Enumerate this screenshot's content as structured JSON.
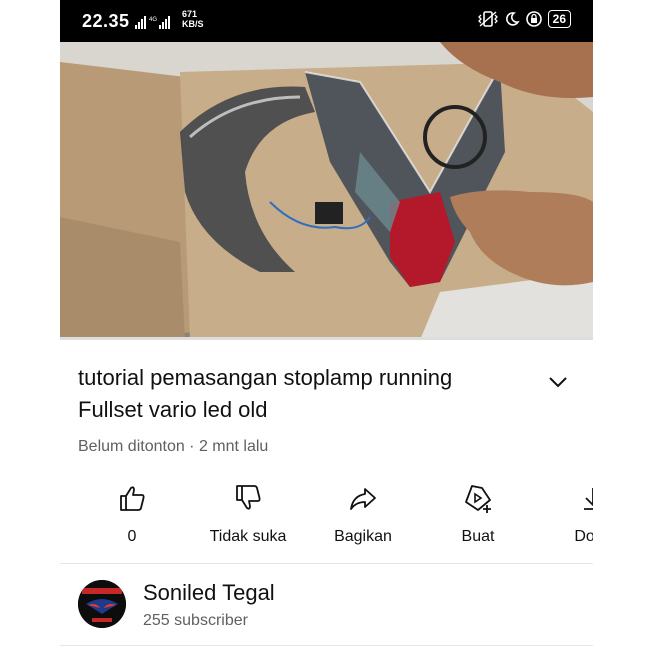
{
  "status_bar": {
    "time": "22.35",
    "network": "4G",
    "speed_value": "671",
    "speed_unit": "KB/S",
    "battery": "26"
  },
  "video": {
    "progress": 0.0,
    "colors": {
      "progress_track": "#dddddd",
      "progress_fill": "#e00000"
    }
  },
  "title": "tutorial pemasangan stoplamp running Fullset vario led old",
  "meta": "Belum ditonton · 2 mnt lalu",
  "actions": [
    {
      "icon": "thumbs-up-icon",
      "label": "0"
    },
    {
      "icon": "thumbs-down-icon",
      "label": "Tidak suka"
    },
    {
      "icon": "share-icon",
      "label": "Bagikan"
    },
    {
      "icon": "create-icon",
      "label": "Buat"
    },
    {
      "icon": "download-icon",
      "label": "Dowr"
    }
  ],
  "channel": {
    "name": "Soniled Tegal",
    "subscribers": "255 subscriber"
  }
}
